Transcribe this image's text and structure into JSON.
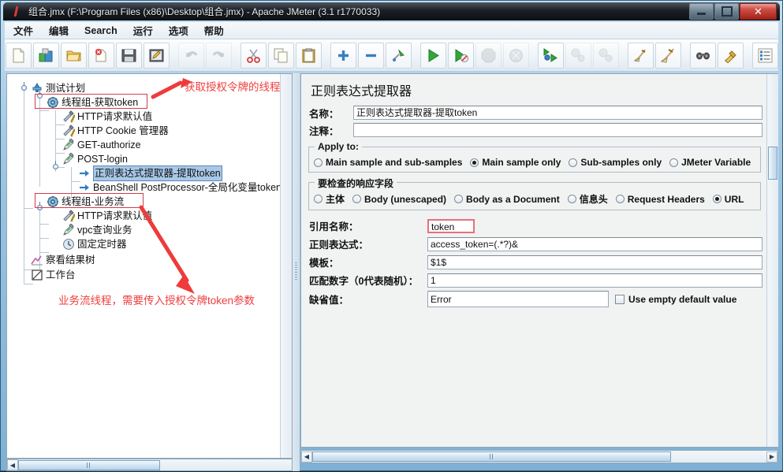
{
  "window": {
    "title": "组合.jmx (F:\\Program Files (x86)\\Desktop\\组合.jmx) - Apache JMeter (3.1 r1770033)",
    "icon": "jmeter-feather-icon",
    "minimize_label": "–",
    "maximize_label": "□",
    "close_label": "✕"
  },
  "menubar": {
    "items": [
      {
        "label": "文件",
        "name": "menu-file"
      },
      {
        "label": "编辑",
        "name": "menu-edit"
      },
      {
        "label": "Search",
        "name": "menu-search"
      },
      {
        "label": "运行",
        "name": "menu-run"
      },
      {
        "label": "选项",
        "name": "menu-options"
      },
      {
        "label": "帮助",
        "name": "menu-help"
      }
    ]
  },
  "toolbar": {
    "buttons": [
      {
        "name": "new-icon",
        "title": "New"
      },
      {
        "name": "templates-icon",
        "title": "Templates"
      },
      {
        "name": "open-icon",
        "title": "Open"
      },
      {
        "name": "close-icon",
        "title": "Close"
      },
      {
        "name": "save-icon",
        "title": "Save"
      },
      {
        "name": "save-as-icon",
        "title": "Save as"
      },
      {
        "name": "undo-icon",
        "title": "Undo",
        "disabled": true
      },
      {
        "name": "redo-icon",
        "title": "Redo",
        "disabled": true
      },
      {
        "name": "cut-icon",
        "title": "Cut"
      },
      {
        "name": "copy-icon",
        "title": "Copy"
      },
      {
        "name": "paste-icon",
        "title": "Paste"
      },
      {
        "name": "expand-all-icon",
        "title": "Expand all"
      },
      {
        "name": "collapse-all-icon",
        "title": "Collapse all"
      },
      {
        "name": "toggle-icon",
        "title": "Toggle"
      },
      {
        "name": "start-icon",
        "title": "Start"
      },
      {
        "name": "start-no-timers-icon",
        "title": "Start no pauses"
      },
      {
        "name": "stop-icon",
        "title": "Stop",
        "disabled": true
      },
      {
        "name": "shutdown-icon",
        "title": "Shutdown",
        "disabled": true
      },
      {
        "name": "remote-start-all-icon",
        "title": "Remote start all"
      },
      {
        "name": "remote-stop-all-icon",
        "title": "Remote stop all",
        "disabled": true
      },
      {
        "name": "remote-shutdown-all-icon",
        "title": "Remote shutdown all",
        "disabled": true
      },
      {
        "name": "clear-icon",
        "title": "Clear"
      },
      {
        "name": "clear-all-icon",
        "title": "Clear all"
      },
      {
        "name": "search-icon",
        "title": "Search"
      },
      {
        "name": "reset-search-icon",
        "title": "Reset search"
      },
      {
        "name": "function-helper-icon",
        "title": "Function Helper Dialog"
      },
      {
        "name": "help-icon",
        "title": "Help"
      }
    ]
  },
  "tree": {
    "nodes": [
      {
        "label": "测试计划",
        "icon": "test-plan-icon",
        "name": "tree-node-test-plan",
        "selected": false
      },
      {
        "label": "线程组-获取token",
        "icon": "thread-group-icon",
        "name": "tree-node-thread-group-token",
        "selected": false
      },
      {
        "label": "HTTP请求默认值",
        "icon": "http-defaults-icon",
        "name": "tree-node-http-defaults-1",
        "selected": false
      },
      {
        "label": "HTTP Cookie 管理器",
        "icon": "cookie-manager-icon",
        "name": "tree-node-cookie-manager",
        "selected": false
      },
      {
        "label": "GET-authorize",
        "icon": "http-sampler-icon",
        "name": "tree-node-get-authorize",
        "selected": false
      },
      {
        "label": "POST-login",
        "icon": "http-sampler-icon",
        "name": "tree-node-post-login",
        "selected": false
      },
      {
        "label": "正则表达式提取器-提取token",
        "icon": "post-processor-icon",
        "name": "tree-node-regex-extractor",
        "selected": true
      },
      {
        "label": "BeanShell PostProcessor-全局化变量token",
        "icon": "post-processor-icon",
        "name": "tree-node-beanshell-postprocessor",
        "selected": false
      },
      {
        "label": "线程组-业务流",
        "icon": "thread-group-icon",
        "name": "tree-node-thread-group-business",
        "selected": false
      },
      {
        "label": "HTTP请求默认值",
        "icon": "http-defaults-icon",
        "name": "tree-node-http-defaults-2",
        "selected": false
      },
      {
        "label": "vpc查询业务",
        "icon": "http-sampler-icon",
        "name": "tree-node-vpc-query",
        "selected": false
      },
      {
        "label": "固定定时器",
        "icon": "constant-timer-icon",
        "name": "tree-node-constant-timer",
        "selected": false
      },
      {
        "label": "察看结果树",
        "icon": "view-results-tree-icon",
        "name": "tree-node-view-results-tree",
        "selected": false
      },
      {
        "label": "工作台",
        "icon": "workbench-icon",
        "name": "tree-node-workbench",
        "selected": false
      }
    ]
  },
  "editor": {
    "title": "正则表达式提取器",
    "name_label": "名称：",
    "name_value": "正则表达式提取器-提取token",
    "comment_label": "注释：",
    "comment_value": "",
    "apply_to": {
      "legend": "Apply to:",
      "options": [
        {
          "label": "Main sample and sub-samples",
          "selected": false,
          "name": "radio-main-and-sub"
        },
        {
          "label": "Main sample only",
          "selected": true,
          "name": "radio-main-only"
        },
        {
          "label": "Sub-samples only",
          "selected": false,
          "name": "radio-sub-only"
        },
        {
          "label": "JMeter Variable",
          "selected": false,
          "name": "radio-jmeter-variable"
        }
      ]
    },
    "response_field": {
      "legend": "要检查的响应字段",
      "options": [
        {
          "label": "主体",
          "selected": false,
          "name": "radio-body"
        },
        {
          "label": "Body (unescaped)",
          "selected": false,
          "name": "radio-body-unescaped"
        },
        {
          "label": "Body as a Document",
          "selected": false,
          "name": "radio-body-as-document"
        },
        {
          "label": "信息头",
          "selected": false,
          "name": "radio-headers"
        },
        {
          "label": "Request Headers",
          "selected": false,
          "name": "radio-request-headers"
        },
        {
          "label": "URL",
          "selected": true,
          "name": "radio-url"
        }
      ]
    },
    "fields": [
      {
        "label": "引用名称：",
        "value": "token",
        "name": "field-reference-name",
        "highlight": true
      },
      {
        "label": "正则表达式：",
        "value": "access_token=(.*?)&",
        "name": "field-regular-expression",
        "highlight": false
      },
      {
        "label": "模板：",
        "value": "$1$",
        "name": "field-template",
        "highlight": false
      },
      {
        "label": "匹配数字（0代表随机）：",
        "value": "1",
        "name": "field-match-no",
        "highlight": false
      }
    ],
    "default_field": {
      "label": "缺省值：",
      "value": "Error",
      "name": "field-default-value",
      "checkbox_label": "Use empty default value",
      "checkbox_checked": false
    }
  },
  "annotations": [
    {
      "text": "获取授权令牌的线程",
      "name": "annotation-top"
    },
    {
      "text": "业务流线程，需要传入授权令牌token参数",
      "name": "annotation-bottom"
    }
  ],
  "colors": {
    "annotation_red": "#ef3e3e",
    "highlight_box": "#d03b4b",
    "selection_blue": "#a8c8e8"
  }
}
